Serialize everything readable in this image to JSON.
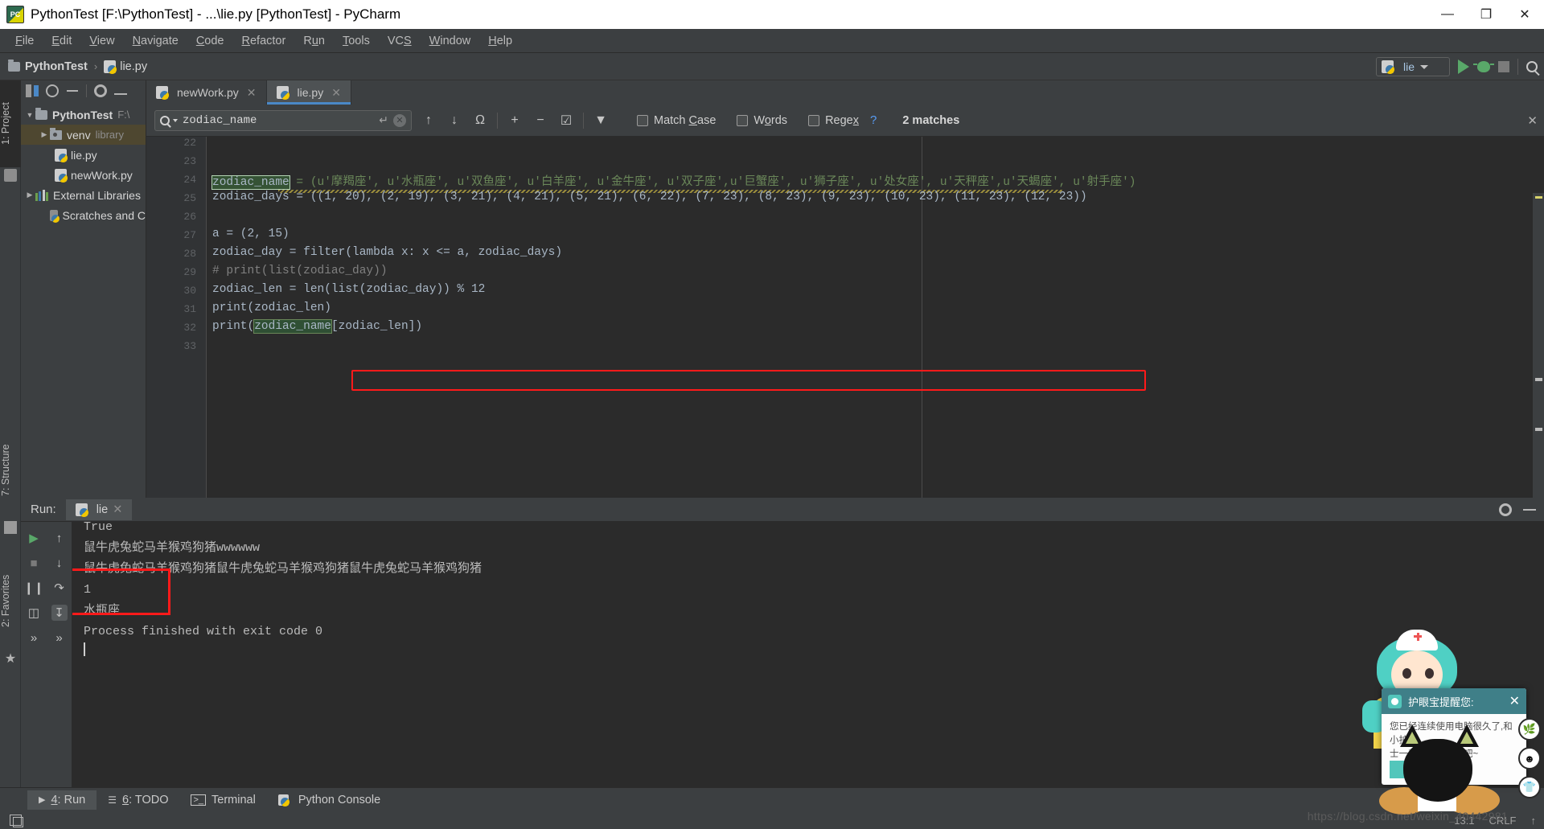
{
  "window": {
    "title": "PythonTest [F:\\PythonTest] - ...\\lie.py [PythonTest] - PyCharm",
    "app_icon": "pycharm-icon",
    "minimize": "—",
    "maximize": "❐",
    "close": "✕"
  },
  "menu": {
    "items": [
      {
        "label": "File",
        "mnemonic": "F"
      },
      {
        "label": "Edit",
        "mnemonic": "E"
      },
      {
        "label": "View",
        "mnemonic": "V"
      },
      {
        "label": "Navigate",
        "mnemonic": "N"
      },
      {
        "label": "Code",
        "mnemonic": "C"
      },
      {
        "label": "Refactor",
        "mnemonic": "R"
      },
      {
        "label": "Run",
        "mnemonic": "u"
      },
      {
        "label": "Tools",
        "mnemonic": "T"
      },
      {
        "label": "VCS",
        "mnemonic": "S"
      },
      {
        "label": "Window",
        "mnemonic": "W"
      },
      {
        "label": "Help",
        "mnemonic": "H"
      }
    ]
  },
  "navbar": {
    "breadcrumbs": [
      "PythonTest",
      "lie.py"
    ],
    "separator": "›",
    "run_config": "lie",
    "buttons": [
      "run-button",
      "debug-button",
      "stop-button",
      "search-everywhere-button"
    ]
  },
  "left_strips": [
    {
      "label": "1: Project",
      "icon": "project-icon",
      "active": true
    },
    {
      "label": "7: Structure",
      "icon": "structure-icon",
      "active": false
    },
    {
      "label": "2: Favorites",
      "icon": "star-icon",
      "active": false
    }
  ],
  "project": {
    "toolbar": [
      "collapse-icon",
      "locate-icon",
      "collapse-all-icon",
      "settings-icon",
      "hide-icon"
    ],
    "tree": [
      {
        "label": "PythonTest",
        "sub": "F:\\",
        "arrow": "▼",
        "icon": "folder-icon",
        "depth": 0,
        "bold": true,
        "selected": false
      },
      {
        "label": "venv",
        "sub": "library",
        "arrow": "▶",
        "icon": "venv-folder-icon",
        "depth": 1,
        "bold": false,
        "selected": true
      },
      {
        "label": "lie.py",
        "sub": "",
        "arrow": "",
        "icon": "python-file-icon",
        "depth": 2,
        "bold": false,
        "selected": false
      },
      {
        "label": "newWork.py",
        "sub": "",
        "arrow": "",
        "icon": "python-file-icon",
        "depth": 2,
        "bold": false,
        "selected": false
      },
      {
        "label": "External Libraries",
        "sub": "",
        "arrow": "▶",
        "icon": "libraries-icon",
        "depth": 0,
        "bold": false,
        "selected": false
      },
      {
        "label": "Scratches and C",
        "sub": "",
        "arrow": "",
        "icon": "scratches-icon",
        "depth": 1,
        "bold": false,
        "selected": false
      }
    ]
  },
  "editor": {
    "tabs": [
      {
        "label": "newWork.py",
        "active": false,
        "close": "✕"
      },
      {
        "label": "lie.py",
        "active": true,
        "close": "✕"
      }
    ],
    "find": {
      "value": "zodiac_name",
      "placeholder": "Search",
      "return_glyph": "↵",
      "clear_glyph": "✕",
      "buttons": [
        "find-previous-icon",
        "find-next-icon",
        "select-all-occurrences-icon",
        "add-selection-icon",
        "remove-selection-icon",
        "select-all-icon",
        "filter-icon"
      ],
      "match_case": "Match Case",
      "words": "Words",
      "regex": "Regex",
      "help": "?",
      "matches": "2 matches",
      "close": "✕"
    },
    "line_numbers": [
      22,
      23,
      24,
      25,
      26,
      27,
      28,
      29,
      30,
      31,
      32,
      33
    ],
    "code": {
      "l24_var": "zodiac_name",
      "l24_rest": " = (u'摩羯座', u'水瓶座', u'双鱼座', u'白羊座', u'金牛座', u'双子座',u'巨蟹座', u'狮子座', u'处女座', u'天秤座',u'天蝎座', u'射手座')",
      "l25": "zodiac_days = ((1, 20), (2, 19), (3, 21), (4, 21), (5, 21), (6, 22), (7, 23), (8, 23), (9, 23), (10, 23), (11, 23), (12, 23))",
      "l27": "a = (2, 15)",
      "l28": "zodiac_day = filter(lambda x: x <= a, zodiac_days)",
      "l29": "# print(list(zodiac_day))",
      "l30": "zodiac_len = len(list(zodiac_day)) % 12",
      "l31": "print(zodiac_len)",
      "l32_pre": "print(",
      "l32_var": "zodiac_name",
      "l32_post": "[zodiac_len])"
    }
  },
  "run_panel": {
    "label": "Run:",
    "tab": "lie",
    "tab_close": "✕",
    "tools_left": [
      "rerun-icon",
      "stop-icon",
      "pause-icon",
      "print-icon",
      "more-icon"
    ],
    "tools_right": [
      "up-icon",
      "down-icon",
      "soft-wrap-icon",
      "scroll-to-end-icon",
      "more-icon"
    ],
    "settings_icon": "gear-icon",
    "hide_icon": "minimize-icon",
    "console": [
      "True",
      "鼠牛虎兔蛇马羊猴鸡狗猪wwwwww",
      "鼠牛虎兔蛇马羊猴鸡狗猪鼠牛虎兔蛇马羊猴鸡狗猪鼠牛虎兔蛇马羊猴鸡狗猪",
      "1",
      "水瓶座",
      "",
      "Process finished with exit code 0"
    ]
  },
  "bottom_tabs": [
    {
      "label": "4: Run",
      "mnemonic": "4",
      "icon": "run-icon",
      "active": true
    },
    {
      "label": "6: TODO",
      "mnemonic": "6",
      "icon": "todo-icon",
      "active": false
    },
    {
      "label": "Terminal",
      "mnemonic": "",
      "icon": "terminal-icon",
      "active": false
    },
    {
      "label": "Python Console",
      "mnemonic": "",
      "icon": "python-console-icon",
      "active": false
    }
  ],
  "status_bar": {
    "caret": "13:1",
    "line_separator": "CRLF",
    "encoding_arrow": "↑",
    "toggle_icon": "toggle-toolwindow-icon"
  },
  "popup": {
    "title": "护眼宝提醒您:",
    "close": "✕",
    "body_line1": "您已经连续使用电脑很久了,和小护",
    "body_line2": "士一起做眼保健操吧~",
    "side_buttons": [
      "plant-icon",
      "face-icon",
      "shirt-icon"
    ]
  },
  "watermark": "https://blog.csdn.net/weixin_40442981",
  "colors": {
    "accent_blue": "#4a88c7",
    "highlight_red": "#ff1a1a",
    "selection_green": "#355335",
    "keyword_orange": "#cc7832",
    "string_green": "#6a8759",
    "number_blue": "#6897bb"
  }
}
